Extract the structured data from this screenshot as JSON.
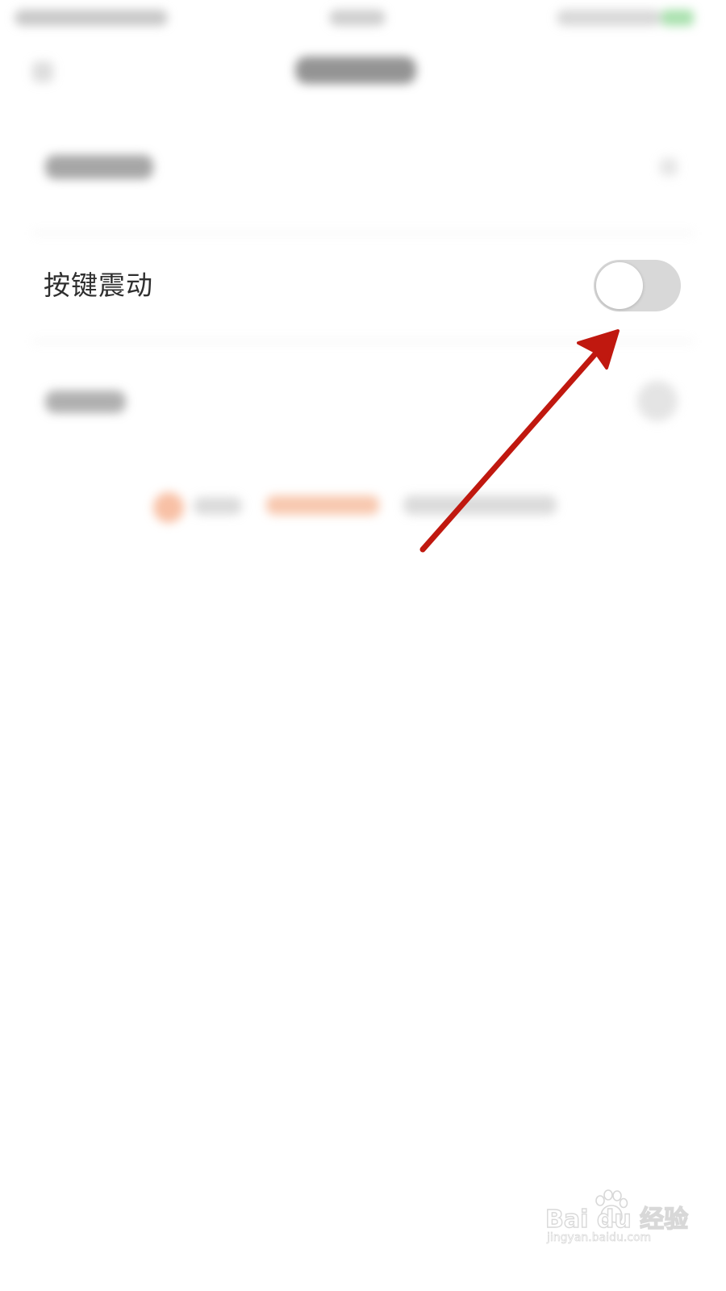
{
  "settings": {
    "key_vibration": {
      "label": "按键震动",
      "enabled": false
    }
  },
  "colors": {
    "toggle_off_track": "#d8d8d8",
    "toggle_knob": "#ffffff",
    "label_text": "#2f2f2f",
    "annotation_arrow": "#c0180f"
  },
  "annotation": {
    "type": "arrow",
    "points_to": "key-vibration-toggle"
  },
  "watermark": {
    "brand": "Bai du 经验",
    "url": "jingyan.baidu.com"
  }
}
